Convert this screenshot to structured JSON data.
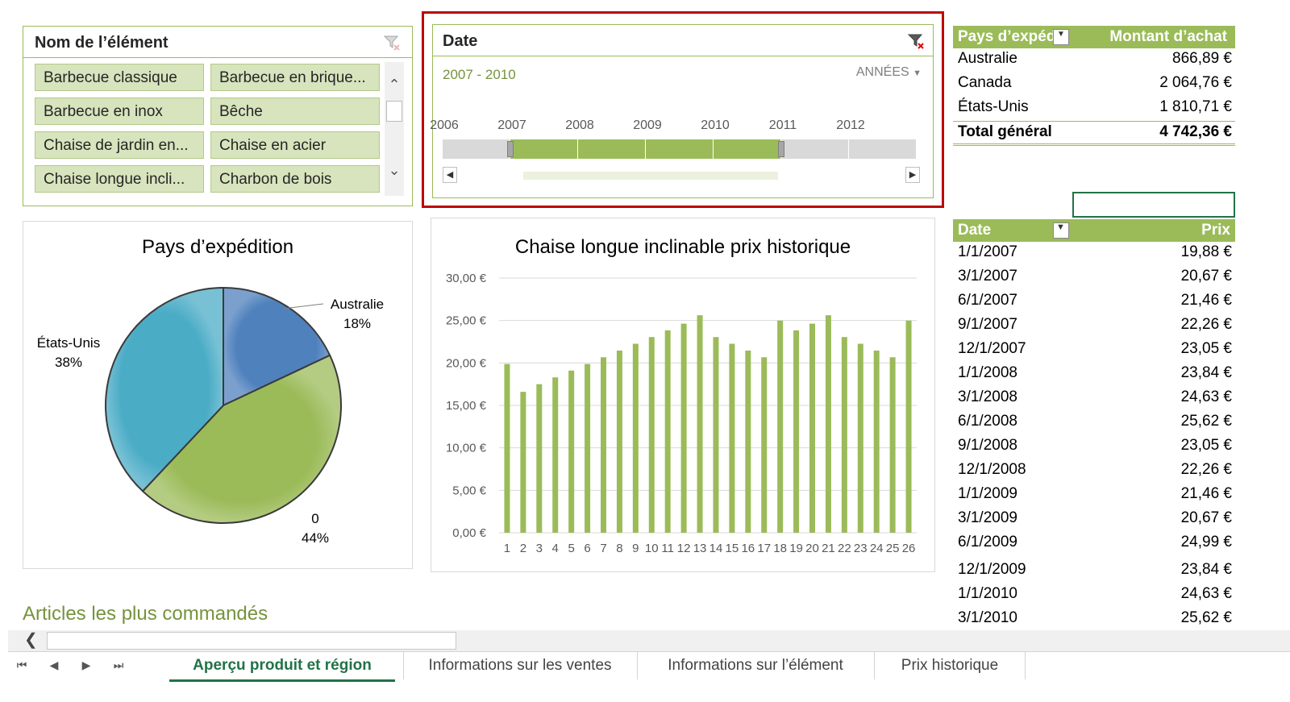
{
  "slicer_item": {
    "title": "Nom de l’élément",
    "items": [
      "Barbecue classique",
      "Barbecue en brique...",
      "Barbecue en inox",
      "Bêche",
      "Chaise de jardin en...",
      "Chaise en acier",
      "Chaise longue incli...",
      "Charbon de bois"
    ]
  },
  "slicer_date": {
    "title": "Date",
    "range": "2007 - 2010",
    "period": "ANNÉES",
    "years": [
      "2006",
      "2007",
      "2008",
      "2009",
      "2010",
      "2011",
      "2012"
    ],
    "selected_years": [
      "2007",
      "2008",
      "2009",
      "2010"
    ]
  },
  "country_pivot": {
    "col1": "Pays d’expédi",
    "col2": "Montant d’achat",
    "rows": [
      {
        "country": "Australie",
        "amount": "866,89 €"
      },
      {
        "country": "Canada",
        "amount": "2 064,76 €"
      },
      {
        "country": "États-Unis",
        "amount": "1 810,71 €"
      }
    ],
    "total_label": "Total général",
    "total_value": "4 742,36 €"
  },
  "price_pivot": {
    "col1": "Date",
    "col2": "Prix",
    "rows": [
      {
        "date": "1/1/2007",
        "price": "19,88 €"
      },
      {
        "date": "3/1/2007",
        "price": "20,67 €"
      },
      {
        "date": "6/1/2007",
        "price": "21,46 €"
      },
      {
        "date": "9/1/2007",
        "price": "22,26 €"
      },
      {
        "date": "12/1/2007",
        "price": "23,05 €"
      },
      {
        "date": "1/1/2008",
        "price": "23,84 €"
      },
      {
        "date": "3/1/2008",
        "price": "24,63 €"
      },
      {
        "date": "6/1/2008",
        "price": "25,62 €"
      },
      {
        "date": "9/1/2008",
        "price": "23,05 €"
      },
      {
        "date": "12/1/2008",
        "price": "22,26 €"
      },
      {
        "date": "1/1/2009",
        "price": "21,46 €"
      },
      {
        "date": "3/1/2009",
        "price": "20,67 €"
      },
      {
        "date": "6/1/2009",
        "price": "24,99 €"
      },
      {
        "date": "12/1/2009",
        "price": "23,84 €"
      },
      {
        "date": "1/1/2010",
        "price": "24,63 €"
      },
      {
        "date": "3/1/2010",
        "price": "25,62 €"
      }
    ]
  },
  "section_heading": "Articles les plus commandés",
  "sheet_tabs": [
    "Aperçu produit et région",
    "Informations sur les ventes",
    "Informations sur l’élément",
    "Prix historique"
  ],
  "colors": {
    "accent_green": "#9bbb59",
    "highlight_red": "#c00000",
    "pie_blue": "#4f81bd",
    "pie_green": "#9bbb59",
    "pie_cyan": "#4bacc6",
    "tab_green": "#217346"
  },
  "chart_data": [
    {
      "type": "pie",
      "title": "Pays d’expédition",
      "slices": [
        {
          "label": "Australie",
          "value": 18,
          "pct_label": "18%",
          "color": "#4f81bd"
        },
        {
          "label": "0",
          "value": 44,
          "pct_label": "44%",
          "color": "#9bbb59"
        },
        {
          "label": "États-Unis",
          "value": 38,
          "pct_label": "38%",
          "color": "#4bacc6"
        }
      ]
    },
    {
      "type": "bar",
      "title": "Chaise longue inclinable prix historique",
      "categories": [
        "1",
        "2",
        "3",
        "4",
        "5",
        "6",
        "7",
        "8",
        "9",
        "10",
        "11",
        "12",
        "13",
        "14",
        "15",
        "16",
        "17",
        "18",
        "19",
        "20",
        "21",
        "22",
        "23",
        "24",
        "25",
        "26"
      ],
      "values": [
        19.88,
        16.6,
        17.5,
        18.3,
        19.1,
        19.88,
        20.67,
        21.46,
        22.26,
        23.05,
        23.84,
        24.63,
        25.62,
        23.05,
        22.26,
        21.46,
        20.67,
        24.99,
        23.84,
        24.63,
        25.62,
        23.05,
        22.26,
        21.46,
        20.67,
        24.99
      ],
      "ylim": [
        0,
        30
      ],
      "yticks": [
        "0,00 €",
        "5,00 €",
        "10,00 €",
        "15,00 €",
        "20,00 €",
        "25,00 €",
        "30,00 €"
      ],
      "grid": true,
      "color": "#9bbb59"
    }
  ]
}
